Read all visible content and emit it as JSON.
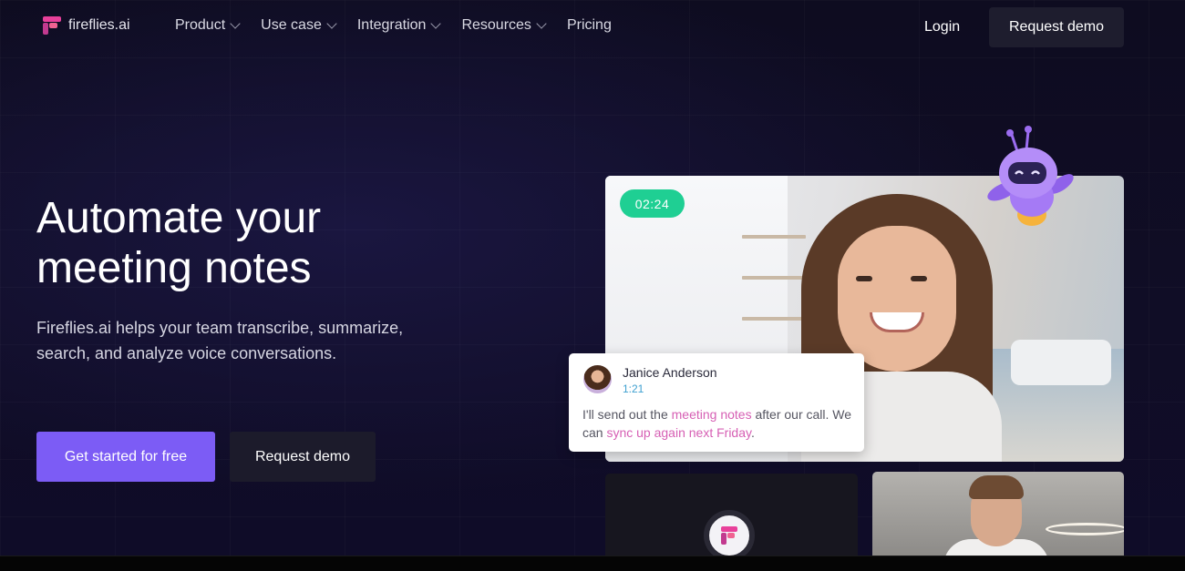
{
  "brand": {
    "name": "fireflies.ai",
    "colors": {
      "primary": "#7c5cf5",
      "logo_pink": "#e8409a",
      "timer_green": "#1fcf93",
      "highlight_pink": "#d65fb4"
    }
  },
  "nav": {
    "links": [
      {
        "label": "Product",
        "has_dropdown": true
      },
      {
        "label": "Use case",
        "has_dropdown": true
      },
      {
        "label": "Integration",
        "has_dropdown": true
      },
      {
        "label": "Resources",
        "has_dropdown": true
      },
      {
        "label": "Pricing",
        "has_dropdown": false
      }
    ],
    "login_label": "Login",
    "demo_label": "Request demo"
  },
  "hero": {
    "title_line1": "Automate your",
    "title_line2": "meeting notes",
    "subtitle": "Fireflies.ai helps your team transcribe, summarize, search, and analyze voice conversations.",
    "cta_primary": "Get started for free",
    "cta_secondary": "Request demo"
  },
  "video": {
    "timer": "02:24",
    "chat": {
      "name": "Janice Anderson",
      "time": "1:21",
      "text_part1": "I'll send out the ",
      "highlight1": "meeting notes",
      "text_part2": " after our call. We can ",
      "highlight2": "sync up again next Friday",
      "text_part3": "."
    }
  },
  "icons": [
    "fireflies-logo-icon",
    "chevron-down-icon",
    "robot-mascot-icon"
  ]
}
